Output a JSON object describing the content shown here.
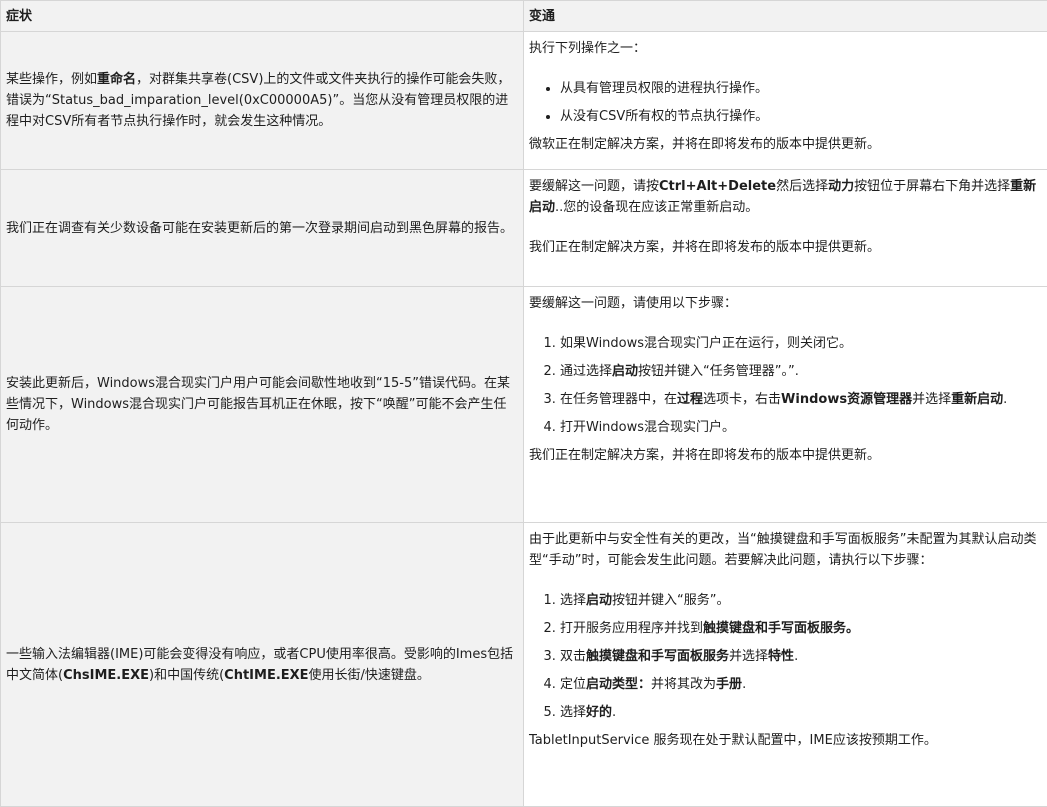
{
  "header": {
    "symptom": "症状",
    "workaround": "变通"
  },
  "rows": [
    {
      "symptom": [
        "某些操作，例如",
        "重命名",
        "，对群集共享卷(CSV)上的文件或文件夹执行的操作可能会失败，错误为“Status_bad_imparation_level(0xC00000A5)”。当您从没有管理员权限的进程中对CSV所有者节点执行操作时，就会发生这种情况。"
      ],
      "intro": "执行下列操作之一：",
      "items": [
        "从具有管理员权限的进程执行操作。",
        "从没有CSV所有权的节点执行操作。"
      ],
      "footer": "微软正在制定解决方案，并将在即将发布的版本中提供更新。"
    },
    {
      "symptom": "我们正在调查有关少数设备可能在安装更新后的第一次登录期间启动到黑色屏幕的报告。",
      "intro": [
        "要缓解这一问题，请按",
        "Ctrl+Alt+Delete",
        "然后选择",
        "动力",
        "按钮位于屏幕右下角并选择",
        "重新启动",
        "..您的设备现在应该正常重新启动。"
      ],
      "footer": "我们正在制定解决方案，并将在即将发布的版本中提供更新。"
    },
    {
      "symptom": "安装此更新后，Windows混合现实门户用户可能会间歇性地收到“15-5”错误代码。在某些情况下，Windows混合现实门户可能报告耳机正在休眠，按下“唤醒”可能不会产生任何动作。",
      "intro": "要缓解这一问题，请使用以下步骤：",
      "steps": [
        [
          "如果Windows混合现实门户正在运行，则关闭它。"
        ],
        [
          "通过选择",
          "启动",
          "按钮并键入“任务管理器”。”."
        ],
        [
          "在任务管理器中，在",
          "过程",
          "选项卡，右击",
          "Windows资源管理器",
          "并选择",
          "重新启动",
          "."
        ],
        [
          "打开Windows混合现实门户。"
        ]
      ],
      "footer": "我们正在制定解决方案，并将在即将发布的版本中提供更新。"
    },
    {
      "symptom": [
        "一些输入法编辑器(IME)可能会变得没有响应，或者CPU使用率很高。受影响的Imes包括中文简体(",
        "ChsIME.EXE",
        ")和中国传统(",
        "ChtIME.EXE",
        "使用长街/快速键盘。"
      ],
      "intro": "由于此更新中与安全性有关的更改，当“触摸键盘和手写面板服务”未配置为其默认启动类型“手动”时，可能会发生此问题。若要解决此问题，请执行以下步骤：",
      "steps": [
        [
          "选择",
          "启动",
          "按钮并键入“服务”。"
        ],
        [
          "打开服务应用程序并找到",
          "触摸键盘和手写面板服务。"
        ],
        [
          "双击",
          "触摸键盘和手写面板服务",
          "并选择",
          "特性",
          "."
        ],
        [
          "定位",
          "启动类型：",
          "并将其改为",
          "手册",
          "."
        ],
        [
          "选择",
          "好的",
          "."
        ]
      ],
      "footer": "TabletInputService 服务现在处于默认配置中，IME应该按预期工作。"
    }
  ]
}
